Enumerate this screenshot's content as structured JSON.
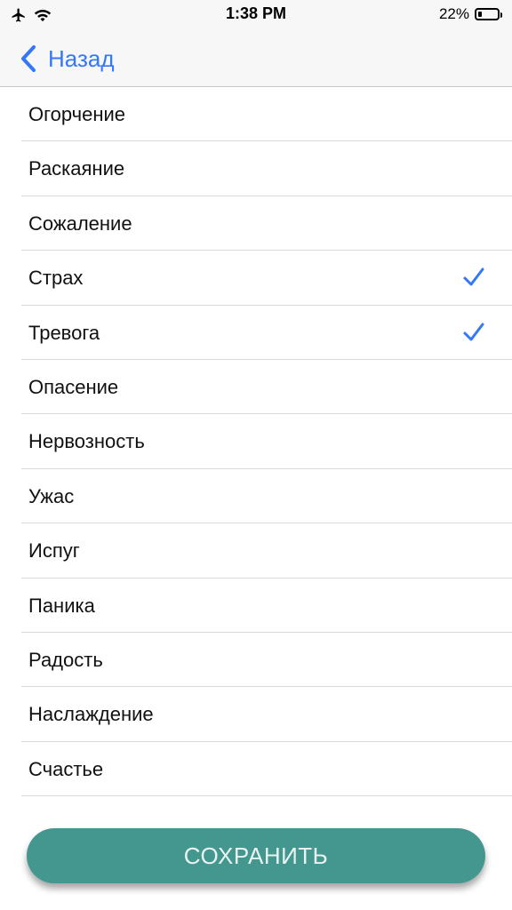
{
  "status_bar": {
    "time": "1:38 PM",
    "battery_text": "22%",
    "battery_level": 0.22,
    "icons": [
      "airplane-icon",
      "wifi-icon",
      "battery-icon"
    ]
  },
  "nav": {
    "back_label": "Назад",
    "icon": "chevron-left-icon"
  },
  "list": {
    "items": [
      {
        "label": "Огорчение",
        "checked": false
      },
      {
        "label": "Раскаяние",
        "checked": false
      },
      {
        "label": "Сожаление",
        "checked": false
      },
      {
        "label": "Страх",
        "checked": true
      },
      {
        "label": "Тревога",
        "checked": true
      },
      {
        "label": "Опасение",
        "checked": false
      },
      {
        "label": "Нервозность",
        "checked": false
      },
      {
        "label": "Ужас",
        "checked": false
      },
      {
        "label": "Испуг",
        "checked": false
      },
      {
        "label": "Паника",
        "checked": false
      },
      {
        "label": "Радость",
        "checked": false
      },
      {
        "label": "Наслаждение",
        "checked": false
      },
      {
        "label": "Счастье",
        "checked": false
      }
    ]
  },
  "footer": {
    "save_label": "СОХРАНИТЬ"
  },
  "colors": {
    "accent": "#3478f6",
    "button": "#44978f",
    "button_text": "#e9f4f2"
  }
}
